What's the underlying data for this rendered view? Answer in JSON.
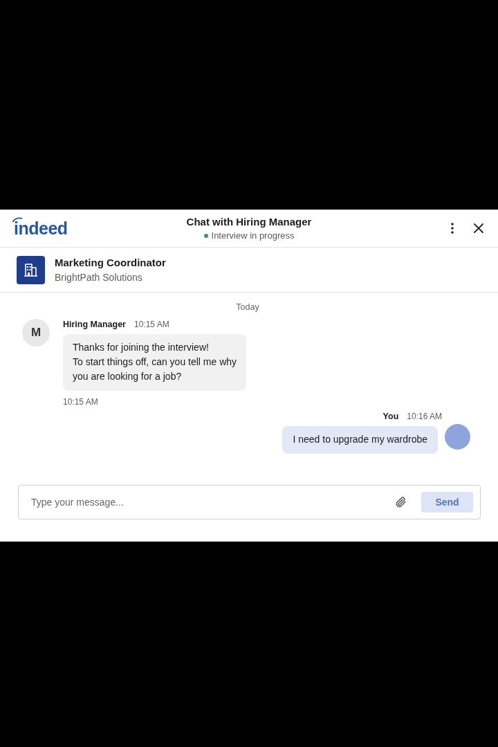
{
  "header": {
    "logo": "indeed",
    "title": "Chat with Hiring Manager",
    "status": "Interview in progress"
  },
  "job": {
    "title": "Marketing Coordinator",
    "company": "BrightPath Solutions"
  },
  "chat": {
    "date_divider": "Today",
    "messages": [
      {
        "kind": "received",
        "avatar_initial": "M",
        "sender": "Hiring Manager",
        "time": "10:15 AM",
        "text": "Thanks for joining the interview!\nTo start things off, can you tell me why\nyou are looking for a job?",
        "footer_time": "10:15 AM"
      },
      {
        "kind": "sent",
        "sender": "You",
        "time": "10:16 AM",
        "text": "I need to upgrade my wardrobe"
      }
    ]
  },
  "composer": {
    "placeholder": "Type your message...",
    "send_label": "Send",
    "send_disabled": true
  }
}
